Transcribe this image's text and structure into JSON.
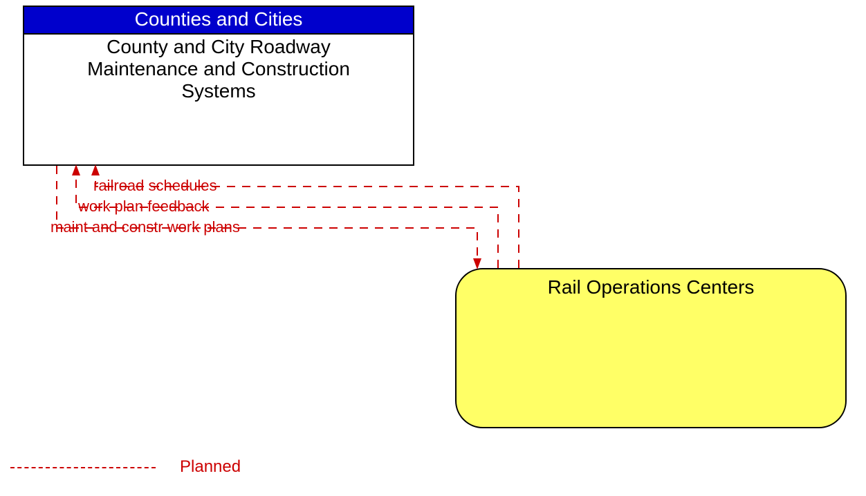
{
  "top_box": {
    "header": "Counties and Cities",
    "body_line1": "County and City Roadway",
    "body_line2": "Maintenance and Construction",
    "body_line3": "Systems"
  },
  "bottom_box": {
    "title": "Rail Operations Centers"
  },
  "flows": {
    "flow1_label": "railroad schedules",
    "flow2_label": "work plan feedback",
    "flow3_label": "maint and constr work plans"
  },
  "legend": {
    "planned_label": "Planned"
  },
  "colors": {
    "header_bg": "#0000cc",
    "bottom_bg": "#ffff66",
    "flow_color": "#cc0000"
  }
}
